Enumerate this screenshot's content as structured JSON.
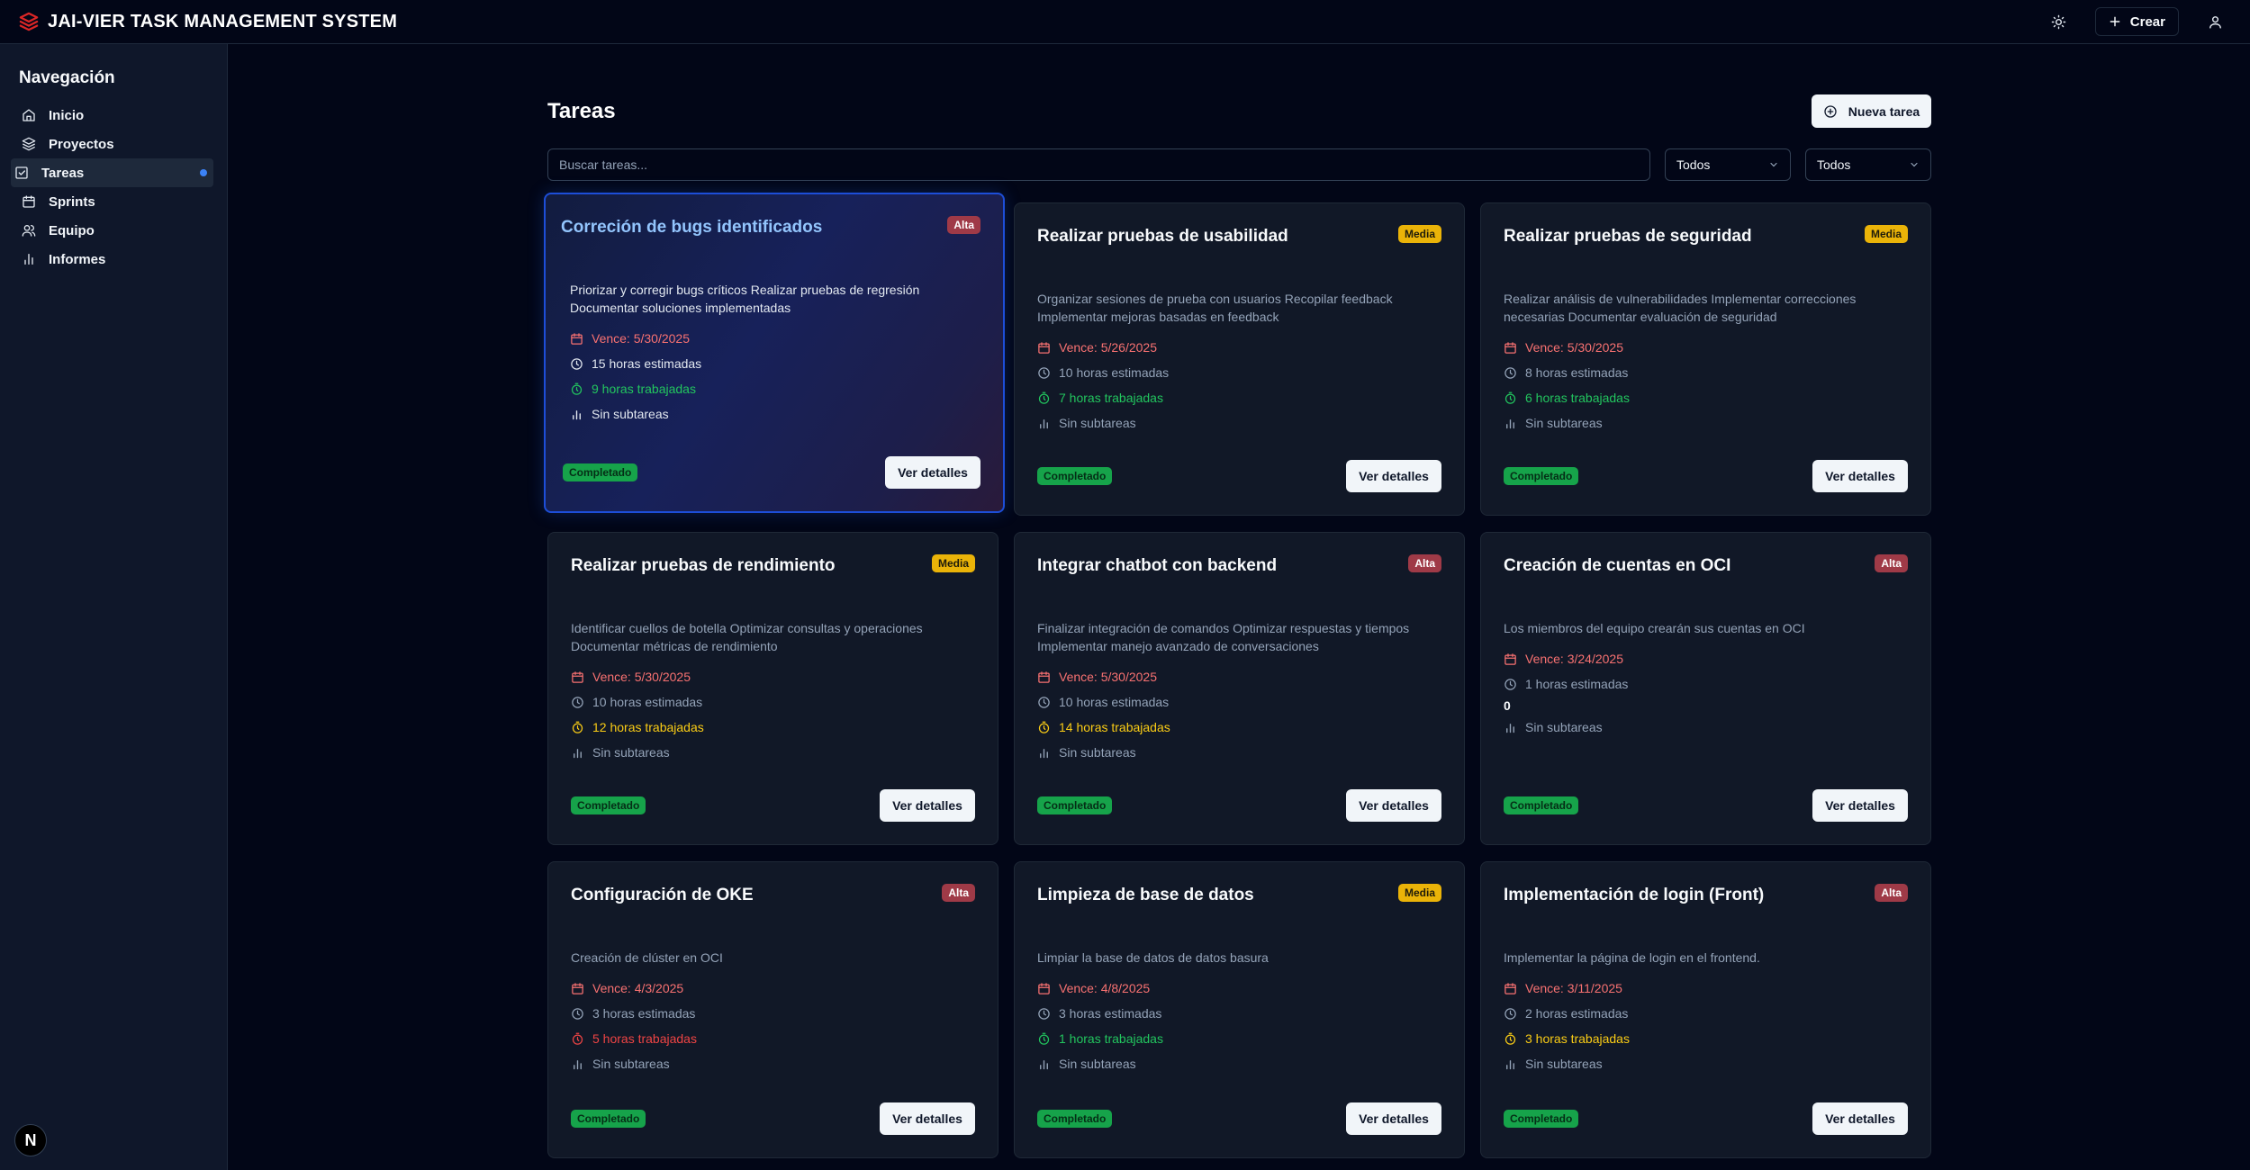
{
  "app": {
    "title": "JAI-VIER TASK MANAGEMENT SYSTEM",
    "create_label": "Crear"
  },
  "sidebar": {
    "title": "Navegación",
    "items": [
      {
        "label": "Inicio",
        "icon": "home-icon"
      },
      {
        "label": "Proyectos",
        "icon": "layers-icon"
      },
      {
        "label": "Tareas",
        "icon": "check-square-icon",
        "active": true
      },
      {
        "label": "Sprints",
        "icon": "calendar-icon"
      },
      {
        "label": "Equipo",
        "icon": "users-icon"
      },
      {
        "label": "Informes",
        "icon": "bar-chart-icon"
      }
    ],
    "badge": "N"
  },
  "main": {
    "title": "Tareas",
    "new_task_label": "Nueva tarea",
    "search_placeholder": "Buscar tareas...",
    "filter_status": "Todos",
    "filter_priority": "Todos"
  },
  "tasks": [
    {
      "title": "Correción de bugs identificados",
      "priority": "Alta",
      "description": "Priorizar y corregir bugs críticos Realizar pruebas de regresión Documentar soluciones implementadas",
      "due": "Vence: 5/30/2025",
      "estimated": "15 horas estimadas",
      "worked": "9 horas trabajadas",
      "worked_color": "green",
      "subtasks": "Sin subtareas",
      "status": "Completado",
      "details_label": "Ver detalles"
    },
    {
      "title": "Realizar pruebas de usabilidad",
      "priority": "Media",
      "description": "Organizar sesiones de prueba con usuarios Recopilar feedback Implementar mejoras basadas en feedback",
      "due": "Vence: 5/26/2025",
      "estimated": "10 horas estimadas",
      "worked": "7 horas trabajadas",
      "worked_color": "green",
      "subtasks": "Sin subtareas",
      "status": "Completado",
      "details_label": "Ver detalles"
    },
    {
      "title": "Realizar pruebas de seguridad",
      "priority": "Media",
      "description": "Realizar análisis de vulnerabilidades Implementar correcciones necesarias Documentar evaluación de seguridad",
      "due": "Vence: 5/30/2025",
      "estimated": "8 horas estimadas",
      "worked": "6 horas trabajadas",
      "worked_color": "green",
      "subtasks": "Sin subtareas",
      "status": "Completado",
      "details_label": "Ver detalles"
    },
    {
      "title": "Realizar pruebas de rendimiento",
      "priority": "Media",
      "description": "Identificar cuellos de botella Optimizar consultas y operaciones Documentar métricas de rendimiento",
      "due": "Vence: 5/30/2025",
      "estimated": "10 horas estimadas",
      "worked": "12 horas trabajadas",
      "worked_color": "yellow",
      "subtasks": "Sin subtareas",
      "status": "Completado",
      "details_label": "Ver detalles"
    },
    {
      "title": "Integrar chatbot con backend",
      "priority": "Alta",
      "description": "Finalizar integración de comandos Optimizar respuestas y tiempos Implementar manejo avanzado de conversaciones",
      "due": "Vence: 5/30/2025",
      "estimated": "10 horas estimadas",
      "worked": "14 horas trabajadas",
      "worked_color": "yellow",
      "subtasks": "Sin subtareas",
      "status": "Completado",
      "details_label": "Ver detalles"
    },
    {
      "title": "Creación de cuentas en OCI",
      "priority": "Alta",
      "description": "Los miembros del equipo crearán sus cuentas en OCI",
      "due": "Vence: 3/24/2025",
      "estimated": "1 horas estimadas",
      "worked": "0",
      "worked_color": "zero",
      "subtasks": "Sin subtareas",
      "status": "Completado",
      "details_label": "Ver detalles"
    },
    {
      "title": "Configuración de OKE",
      "priority": "Alta",
      "description": "Creación de clúster en OCI",
      "due": "Vence: 4/3/2025",
      "estimated": "3 horas estimadas",
      "worked": "5 horas trabajadas",
      "worked_color": "red",
      "subtasks": "Sin subtareas",
      "status": "Completado",
      "details_label": "Ver detalles"
    },
    {
      "title": "Limpieza de base de datos",
      "priority": "Media",
      "description": "Limpiar la base de datos de datos basura",
      "due": "Vence: 4/8/2025",
      "estimated": "3 horas estimadas",
      "worked": "1 horas trabajadas",
      "worked_color": "green",
      "subtasks": "Sin subtareas",
      "status": "Completado",
      "details_label": "Ver detalles"
    },
    {
      "title": "Implementación de login (Front)",
      "priority": "Alta",
      "description": "Implementar la página de login en el frontend.",
      "due": "Vence: 3/11/2025",
      "estimated": "2 horas estimadas",
      "worked": "3 horas trabajadas",
      "worked_color": "yellow",
      "subtasks": "Sin subtareas",
      "status": "Completado",
      "details_label": "Ver detalles"
    }
  ]
}
